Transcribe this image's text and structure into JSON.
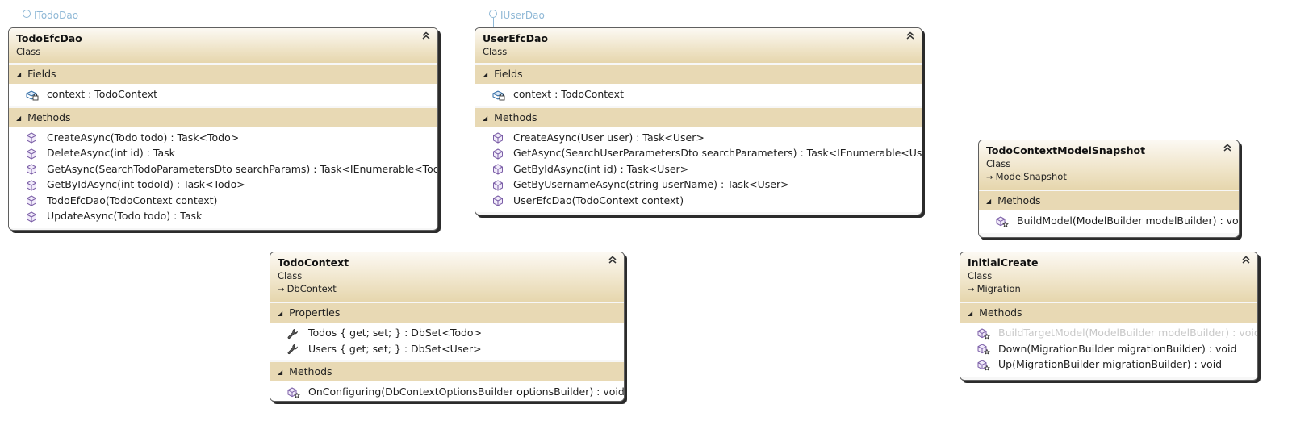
{
  "interfaces": [
    {
      "name": "ITodoDao"
    },
    {
      "name": "IUserDao"
    }
  ],
  "classes": {
    "todoEfcDao": {
      "name": "TodoEfcDao",
      "kind": "Class",
      "base": null,
      "sections": [
        {
          "title": "Fields",
          "members": [
            {
              "text": "context : TodoContext",
              "icon": "private-field-icon"
            }
          ]
        },
        {
          "title": "Methods",
          "members": [
            {
              "text": "CreateAsync(Todo todo) : Task<Todo>",
              "icon": "method-icon"
            },
            {
              "text": "DeleteAsync(int id) : Task",
              "icon": "method-icon"
            },
            {
              "text": "GetAsync(SearchTodoParametersDto searchParams) : Task<IEnumerable<Todo>>",
              "icon": "method-icon"
            },
            {
              "text": "GetByIdAsync(int todoId) : Task<Todo>",
              "icon": "method-icon"
            },
            {
              "text": "TodoEfcDao(TodoContext context)",
              "icon": "method-icon"
            },
            {
              "text": "UpdateAsync(Todo todo) : Task",
              "icon": "method-icon"
            }
          ]
        }
      ]
    },
    "userEfcDao": {
      "name": "UserEfcDao",
      "kind": "Class",
      "base": null,
      "sections": [
        {
          "title": "Fields",
          "members": [
            {
              "text": "context : TodoContext",
              "icon": "private-field-icon"
            }
          ]
        },
        {
          "title": "Methods",
          "members": [
            {
              "text": "CreateAsync(User user) : Task<User>",
              "icon": "method-icon"
            },
            {
              "text": "GetAsync(SearchUserParametersDto searchParameters) : Task<IEnumerable<User>>",
              "icon": "method-icon"
            },
            {
              "text": "GetByIdAsync(int id) : Task<User>",
              "icon": "method-icon"
            },
            {
              "text": "GetByUsernameAsync(string userName) : Task<User>",
              "icon": "method-icon"
            },
            {
              "text": "UserEfcDao(TodoContext context)",
              "icon": "method-icon"
            }
          ]
        }
      ]
    },
    "todoContextModelSnapshot": {
      "name": "TodoContextModelSnapshot",
      "kind": "Class",
      "base": "ModelSnapshot",
      "sections": [
        {
          "title": "Methods",
          "members": [
            {
              "text": "BuildModel(ModelBuilder modelBuilder) : void",
              "icon": "protected-override-method-icon"
            }
          ]
        }
      ]
    },
    "todoContext": {
      "name": "TodoContext",
      "kind": "Class",
      "base": "DbContext",
      "sections": [
        {
          "title": "Properties",
          "members": [
            {
              "text": "Todos { get; set; } : DbSet<Todo>",
              "icon": "property-wrench-icon"
            },
            {
              "text": "Users { get; set; } : DbSet<User>",
              "icon": "property-wrench-icon"
            }
          ]
        },
        {
          "title": "Methods",
          "members": [
            {
              "text": "OnConfiguring(DbContextOptionsBuilder optionsBuilder) : void",
              "icon": "protected-override-method-icon"
            }
          ]
        }
      ]
    },
    "initialCreate": {
      "name": "InitialCreate",
      "kind": "Class",
      "base": "Migration",
      "sections": [
        {
          "title": "Methods",
          "members": [
            {
              "text": "BuildTargetModel(ModelBuilder modelBuilder) : void",
              "icon": "protected-override-method-icon",
              "dim": true
            },
            {
              "text": "Down(MigrationBuilder migrationBuilder) : void",
              "icon": "protected-override-method-icon"
            },
            {
              "text": "Up(MigrationBuilder migrationBuilder) : void",
              "icon": "protected-override-method-icon"
            }
          ]
        }
      ]
    }
  },
  "colors": {
    "header_gradient_end": "#e6d6ad",
    "section_band": "#e8d9b4",
    "interface_blue": "#8fb8d6",
    "method_purple": "#7b5ea7"
  }
}
